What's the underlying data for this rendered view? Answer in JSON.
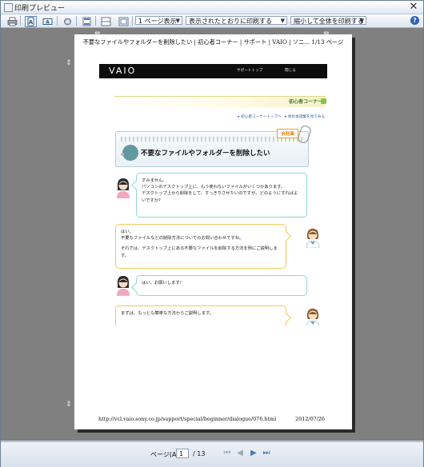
{
  "window": {
    "title": "印刷プレビュー",
    "close_glyph": "✕"
  },
  "toolbar": {
    "print_icon": "printer-icon",
    "pages_dropdown": "1 ページ表示",
    "size_dropdown": "表示されたとおりに印刷する",
    "scale_dropdown": "縮小して全体を印刷する",
    "help_label": "?"
  },
  "page": {
    "header": "不要なファイルやフォルダーを削除したい | 初心者コーナー | サポート | VAIO | ソニ... 1/13 ページ",
    "footer_url": "http://vcl.vaio.sony.co.jp/support/special/beginner/dialogue/076.html",
    "footer_date": "2012/07/26"
  },
  "site": {
    "logo": "VAIO",
    "nav_support": "サポートトップ",
    "nav_close": "閉じる",
    "corner_title": "初心者コーナー",
    "corner_links": "▸ 初心者コーナートップへ　▸ 他の会話集を見てみる",
    "series_tag": "会話集",
    "article_title": "不要なファイルやフォルダーを削除したい"
  },
  "dialogue": [
    {
      "speaker": "user",
      "lines": [
        "すみません。",
        "パソコンのデスクトップ上に、もう使わないファイルがいくつかあります。",
        "デスクトップ上から削除をして、すっきりさせたいのですが、どのようにすればよいですか?"
      ]
    },
    {
      "speaker": "staff",
      "lines": [
        "はい。",
        "不要なファイルなどの削除方法についてのお問い合わせですね。",
        "",
        "それでは、デスクトップ上にある不要なファイルを削除する方法を例にご説明します。"
      ]
    },
    {
      "speaker": "user",
      "lines": [
        "はい、お願いします！"
      ]
    },
    {
      "speaker": "staff",
      "lines": [
        "まずは、もっとも簡単な方法からご説明します。"
      ]
    }
  ],
  "statusbar": {
    "page_label": "ページ(A)",
    "page_value": "1",
    "page_total": "/ 13"
  },
  "colors": {
    "question_border": "#8fd6d7",
    "answer_border": "#f3c85a",
    "viewport": "#808080"
  }
}
